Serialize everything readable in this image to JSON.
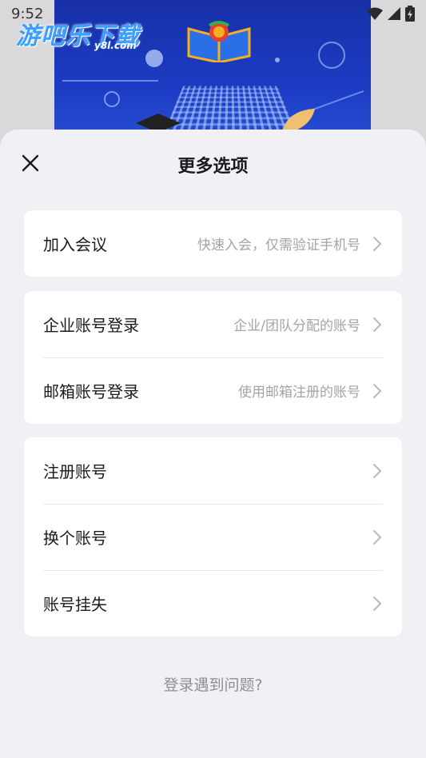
{
  "status_bar": {
    "time": "9:52"
  },
  "watermark": {
    "text": "游吧乐下载",
    "sub": "y8l.com"
  },
  "sheet": {
    "title": "更多选项",
    "groups": [
      {
        "items": [
          {
            "label": "加入会议",
            "hint": "快速入会，仅需验证手机号"
          }
        ]
      },
      {
        "items": [
          {
            "label": "企业账号登录",
            "hint": "企业/团队分配的账号"
          },
          {
            "label": "邮箱账号登录",
            "hint": "使用邮箱注册的账号"
          }
        ]
      },
      {
        "items": [
          {
            "label": "注册账号",
            "hint": ""
          },
          {
            "label": "换个账号",
            "hint": ""
          },
          {
            "label": "账号挂失",
            "hint": ""
          }
        ]
      }
    ],
    "help_link": "登录遇到问题?"
  },
  "colors": {
    "sheet_bg": "#f0f0f5",
    "card_bg": "#ffffff",
    "hint_text": "#a3a3a8",
    "poster_blue": "#1c3cc4"
  },
  "icons": {
    "close": "close-icon",
    "chevron": "chevron-right-icon",
    "wifi": "wifi-icon",
    "signal": "signal-icon",
    "battery": "battery-icon"
  }
}
